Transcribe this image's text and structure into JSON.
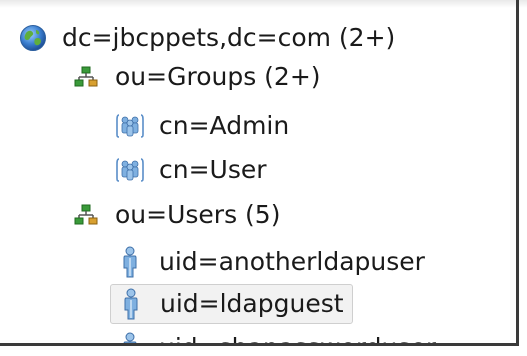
{
  "tree": {
    "root": {
      "label": "dc=jbcppets,dc=com (2+)",
      "icon": "globe-icon"
    },
    "groups_ou": {
      "label": "ou=Groups (2+)",
      "icon": "org-unit-icon"
    },
    "groups": [
      {
        "label": "cn=Admin",
        "icon": "group-icon"
      },
      {
        "label": "cn=User",
        "icon": "group-icon"
      }
    ],
    "users_ou": {
      "label": "ou=Users (5)",
      "icon": "org-unit-icon"
    },
    "users": [
      {
        "label": "uid=anotherldapuser",
        "icon": "person-icon"
      },
      {
        "label": "uid=ldapguest",
        "icon": "person-icon",
        "selected": true
      },
      {
        "label": "uid=shapassworduser",
        "icon": "person-icon"
      }
    ]
  },
  "colors": {
    "selection_bg": "#f2f2f2",
    "selection_border": "#cfcfcf",
    "text": "#1a1a1a",
    "org_unit_green": "#3a9a3a",
    "person_blue": "#5a8ec8"
  }
}
